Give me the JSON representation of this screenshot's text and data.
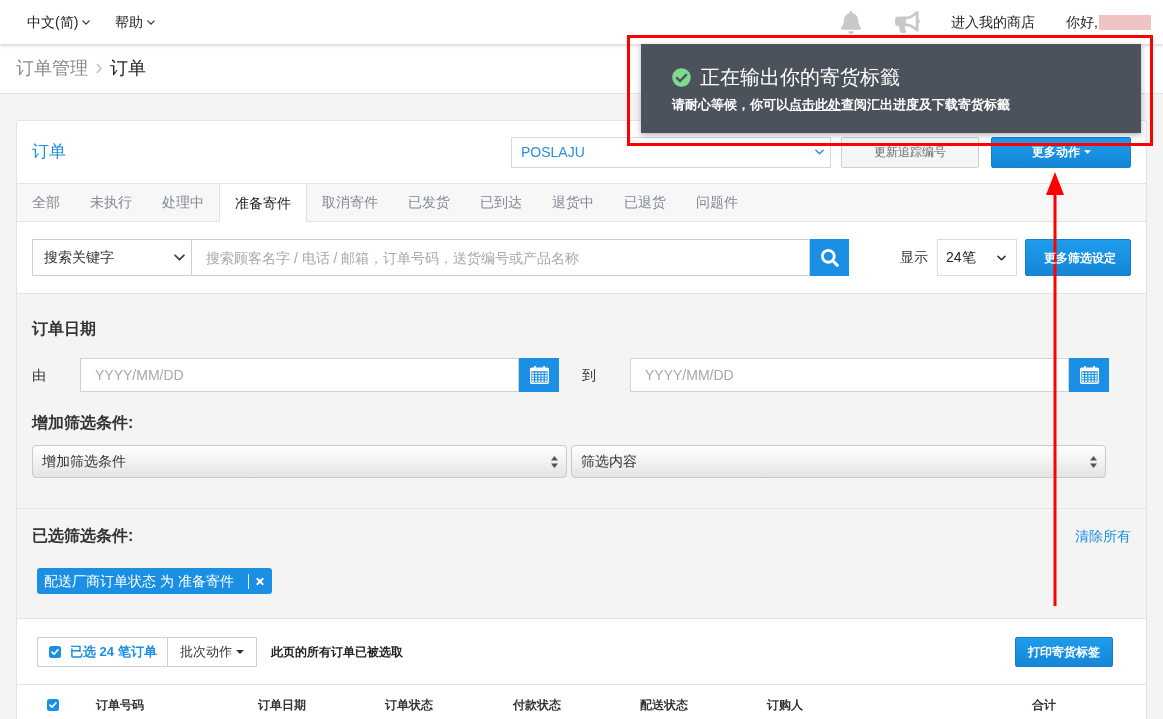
{
  "top_bar": {
    "menus": [
      {
        "label": "中文(简)"
      },
      {
        "label": "帮助"
      }
    ],
    "store_link": "进入我的商店",
    "greeting": "你好,"
  },
  "breadcrumb": [
    "订单管理",
    "订单"
  ],
  "toast": {
    "title": "正在输出你的寄货标籤",
    "message": {
      "before": "请耐心等候，你可以",
      "link": "点击此处",
      "after": "查阅汇出进度及下载寄货标籤"
    }
  },
  "panel": {
    "title": "订单",
    "courier_select": "POSLAJU",
    "buttons": [
      {
        "label": "更新追踪编号",
        "kind": "secondary"
      },
      {
        "label": "更多动作",
        "kind": "primary",
        "menu": true
      }
    ]
  },
  "tabs": [
    {
      "label": "全部",
      "selected": false
    },
    {
      "label": "未执行",
      "selected": false
    },
    {
      "label": "处理中",
      "selected": false
    },
    {
      "label": "准备寄件",
      "selected": true
    },
    {
      "label": "取消寄件",
      "selected": false
    },
    {
      "label": "已发货",
      "selected": false
    },
    {
      "label": "已到达",
      "selected": false
    },
    {
      "label": "退货中",
      "selected": false
    },
    {
      "label": "已退货",
      "selected": false
    },
    {
      "label": "问题件",
      "selected": false
    }
  ],
  "search": {
    "field_select": "搜索关键字",
    "placeholder": "搜索顾客名字 / 电话 / 邮箱，订单号码，送货编号或产品名称",
    "show_label": "显示",
    "page_size": "24笔",
    "more_filters_button": "更多筛选设定"
  },
  "date_filter": {
    "title": "订单日期",
    "ranges": [
      {
        "label": "由",
        "placeholder": "YYYY/MM/DD"
      },
      {
        "label": "到",
        "placeholder": "YYYY/MM/DD"
      }
    ]
  },
  "add_filter": {
    "title": "增加筛选条件:",
    "selects": [
      "增加筛选条件",
      "筛选内容"
    ]
  },
  "selected_filters": {
    "title": "已选筛选条件:",
    "clear_all": "清除所有",
    "chips": [
      "配送厂商订单状态 为 准备寄件"
    ]
  },
  "bulk_bar": {
    "select_all": {
      "checked": true,
      "label": "已选 24 笔订单"
    },
    "batch_button": "批次动作",
    "note": "此页的所有订单已被选取",
    "print_button": "打印寄货标签"
  },
  "table": {
    "select_all": {
      "checked": true
    },
    "columns": [
      "订单号码",
      "订单日期",
      "订单状态",
      "付款状态",
      "配送状态",
      "订购人",
      "合计"
    ]
  }
}
